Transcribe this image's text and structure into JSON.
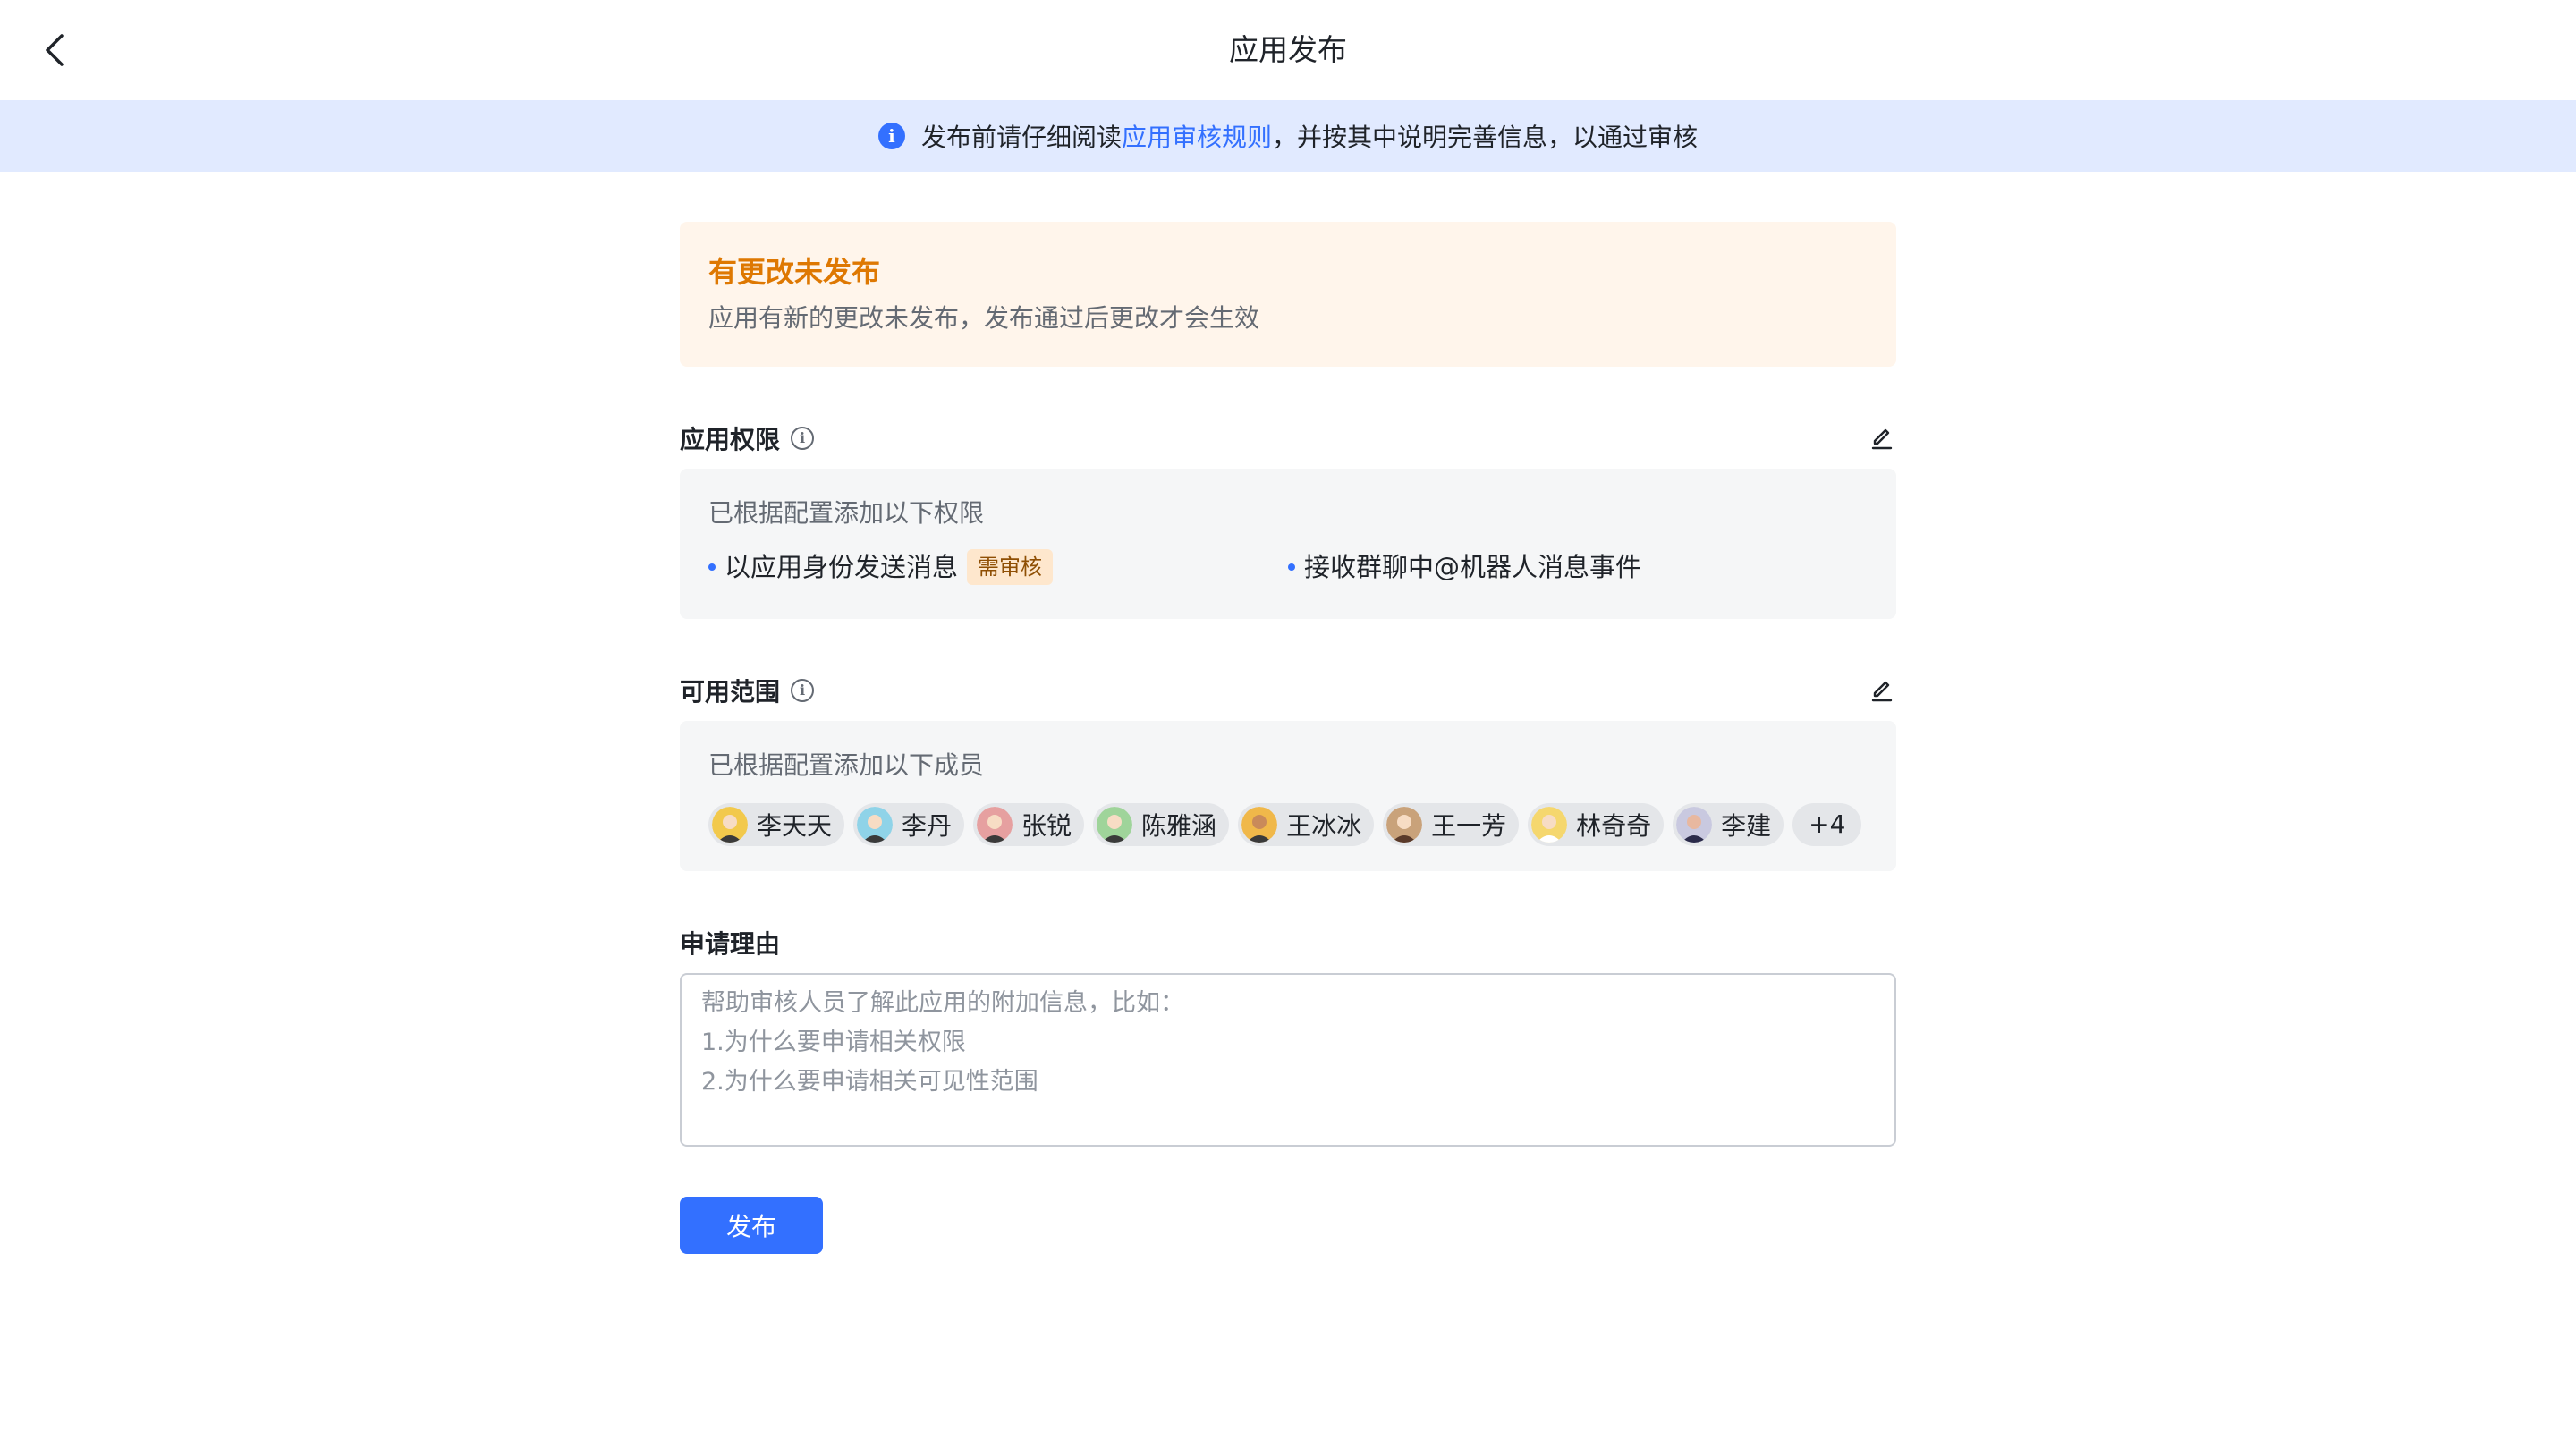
{
  "header": {
    "title": "应用发布",
    "back_icon": "chevron-left-icon"
  },
  "notice": {
    "icon": "info-icon",
    "prefix": "发布前请仔细阅读",
    "link": "应用审核规则",
    "suffix": "，并按其中说明完善信息，以通过审核"
  },
  "alert": {
    "title": "有更改未发布",
    "description": "应用有新的更改未发布，发布通过后更改才会生效",
    "colors": {
      "background": "#fff5eb",
      "title": "#de7802"
    }
  },
  "permissions": {
    "label": "应用权限",
    "caption": "已根据配置添加以下权限",
    "items": [
      {
        "text": "以应用身份发送消息",
        "badge": "需审核"
      },
      {
        "text": "接收群聊中@机器人消息事件",
        "badge": ""
      }
    ]
  },
  "scope": {
    "label": "可用范围",
    "caption": "已根据配置添加以下成员",
    "members": [
      {
        "name": "李天天",
        "avatar_color": "#f2c94c"
      },
      {
        "name": "李丹",
        "avatar_color": "#8fd3e8"
      },
      {
        "name": "张锐",
        "avatar_color": "#e6a0a0"
      },
      {
        "name": "陈雅涵",
        "avatar_color": "#9fd49a"
      },
      {
        "name": "王冰冰",
        "avatar_color": "#f0b84a"
      },
      {
        "name": "王一芳",
        "avatar_color": "#c9a27a"
      },
      {
        "name": "林奇奇",
        "avatar_color": "#f5d76e"
      },
      {
        "name": "李建",
        "avatar_color": "#c9c9e0"
      }
    ],
    "more": "+4"
  },
  "reason": {
    "label": "申请理由",
    "placeholder": "帮助审核人员了解此应用的附加信息，比如：\n1.为什么要申请相关权限\n2.为什么要申请相关可见性范围",
    "value": ""
  },
  "actions": {
    "publish_label": "发布"
  },
  "colors": {
    "accent": "#3370ff",
    "notice_bg": "#e1eaff",
    "panel_bg": "#f5f6f7"
  }
}
